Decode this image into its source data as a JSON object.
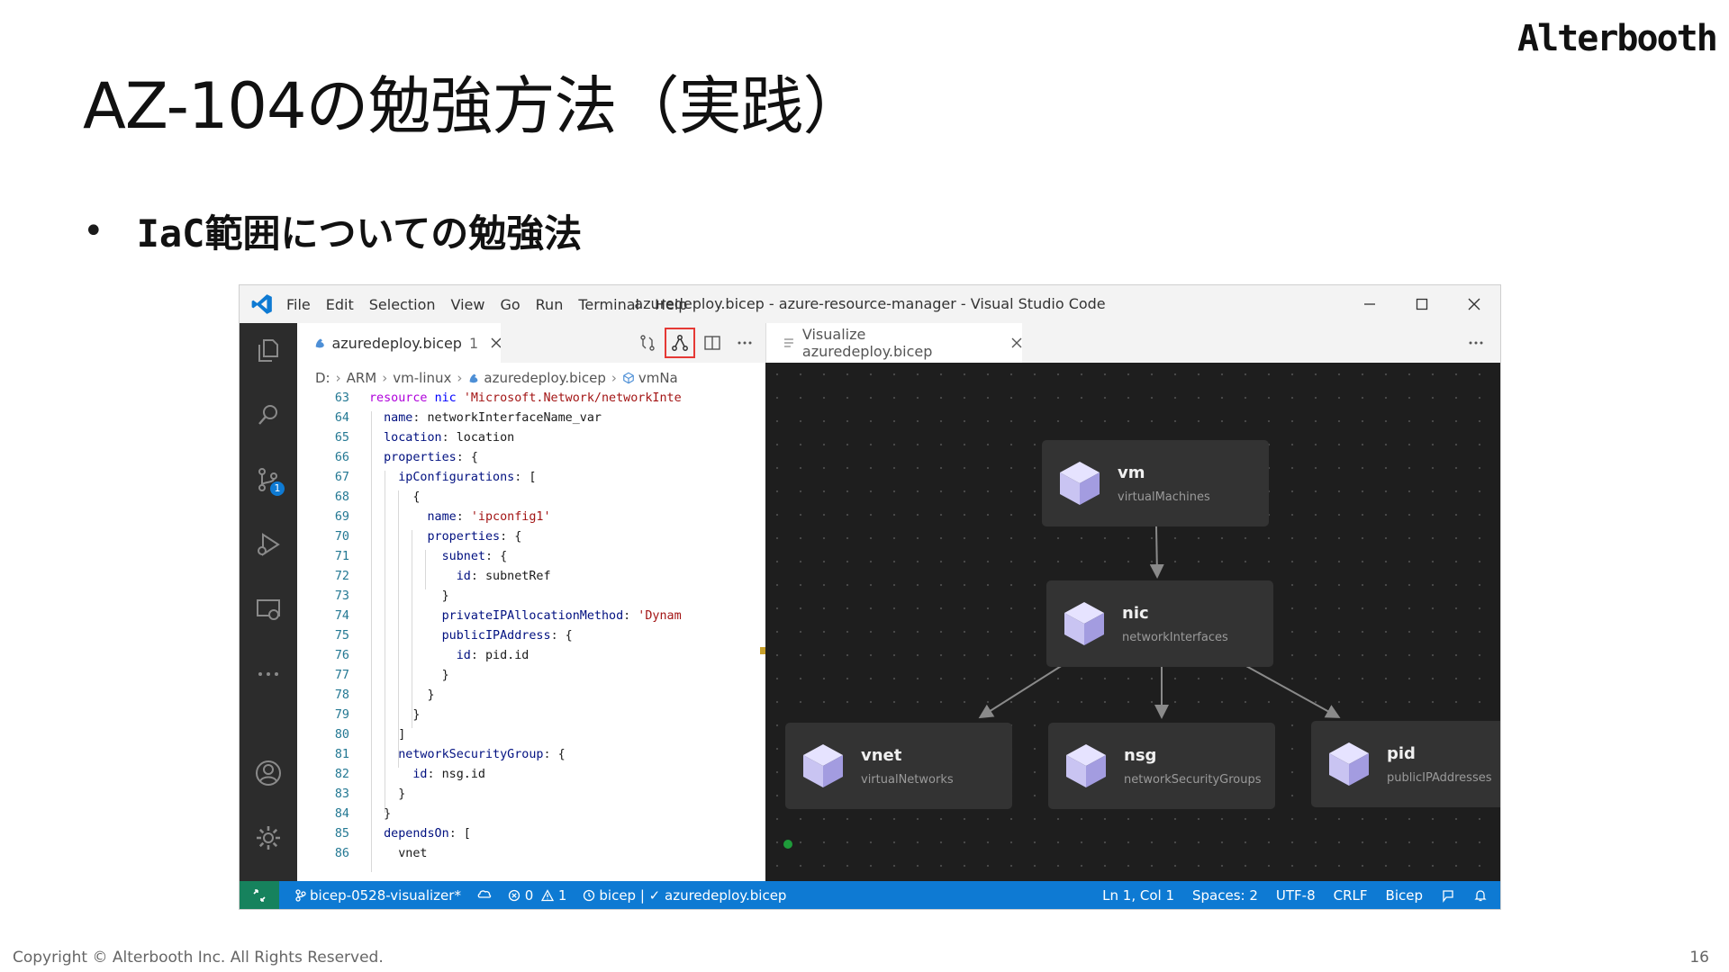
{
  "slide": {
    "title": "AZ-104の勉強方法（実践）",
    "bullet": "IaC範囲についての勉強法",
    "logo": "Alterbooth",
    "copyright": "Copyright © Alterbooth Inc. All Rights Reserved.",
    "page_number": "16"
  },
  "vscode": {
    "menu": [
      "File",
      "Edit",
      "Selection",
      "View",
      "Go",
      "Run",
      "Terminal",
      "Help"
    ],
    "window_title": "azuredeploy.bicep - azure-resource-manager - Visual Studio Code",
    "editor_tab": {
      "label": "azuredeploy.bicep",
      "problems": "1"
    },
    "breadcrumb": [
      "D:",
      "ARM",
      "vm-linux",
      "azuredeploy.bicep",
      "vmNa"
    ],
    "viz_tab_label": "Visualize azuredeploy.bicep",
    "scm_badge": "1",
    "code_lines": [
      {
        "n": "63",
        "t": "resource nic 'Microsoft.Network/networkInte"
      },
      {
        "n": "64",
        "t": "  name: networkInterfaceName_var"
      },
      {
        "n": "65",
        "t": "  location: location"
      },
      {
        "n": "66",
        "t": "  properties: {"
      },
      {
        "n": "67",
        "t": "    ipConfigurations: ["
      },
      {
        "n": "68",
        "t": "      {"
      },
      {
        "n": "69",
        "t": "        name: 'ipconfig1'"
      },
      {
        "n": "70",
        "t": "        properties: {"
      },
      {
        "n": "71",
        "t": "          subnet: {"
      },
      {
        "n": "72",
        "t": "            id: subnetRef"
      },
      {
        "n": "73",
        "t": "          }"
      },
      {
        "n": "74",
        "t": "          privateIPAllocationMethod: 'Dynam"
      },
      {
        "n": "75",
        "t": "          publicIPAddress: {"
      },
      {
        "n": "76",
        "t": "            id: pid.id"
      },
      {
        "n": "77",
        "t": "          }"
      },
      {
        "n": "78",
        "t": "        }"
      },
      {
        "n": "79",
        "t": "      }"
      },
      {
        "n": "80",
        "t": "    ]"
      },
      {
        "n": "81",
        "t": "    networkSecurityGroup: {"
      },
      {
        "n": "82",
        "t": "      id: nsg.id"
      },
      {
        "n": "83",
        "t": "    }"
      },
      {
        "n": "84",
        "t": "  }"
      },
      {
        "n": "85",
        "t": "  dependsOn: ["
      },
      {
        "n": "86",
        "t": "    vnet"
      }
    ],
    "nodes": [
      {
        "name": "vm",
        "type": "virtualMachines"
      },
      {
        "name": "nic",
        "type": "networkInterfaces"
      },
      {
        "name": "vnet",
        "type": "virtualNetworks"
      },
      {
        "name": "nsg",
        "type": "networkSecurityGroups"
      },
      {
        "name": "pid",
        "type": "publicIPAddresses"
      }
    ],
    "status": {
      "branch": "bicep-0528-visualizer*",
      "errors": "0",
      "warnings": "1",
      "language_status": "bicep | ✓ azuredeploy.bicep",
      "cursor": "Ln 1, Col 1",
      "spaces": "Spaces: 2",
      "encoding": "UTF-8",
      "eol": "CRLF",
      "language": "Bicep"
    }
  },
  "colors": {
    "statusbar": "#0e7ad3",
    "activitybar": "#2c2c2c",
    "viz_background": "#1e1e1e",
    "node_background": "#333333",
    "highlight_box": "#e53935"
  }
}
